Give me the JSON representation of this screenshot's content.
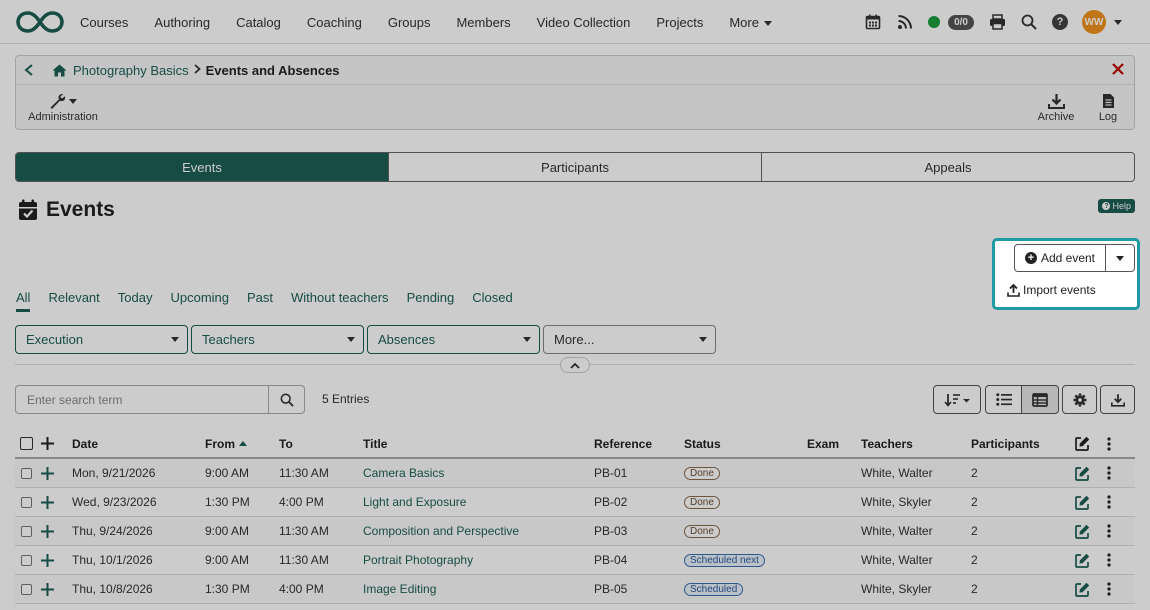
{
  "nav": {
    "items": [
      "Courses",
      "Authoring",
      "Catalog",
      "Coaching",
      "Groups",
      "Members",
      "Video Collection",
      "Projects",
      "More"
    ],
    "counter": "0/0",
    "avatar_initials": "WW",
    "help": "?"
  },
  "breadcrumb": {
    "parent": "Photography Basics",
    "current": "Events and Absences"
  },
  "toolbar": {
    "administration": "Administration",
    "archive": "Archive",
    "log": "Log"
  },
  "tabs": [
    "Events",
    "Participants",
    "Appeals"
  ],
  "page": {
    "title": "Events",
    "help": "Help"
  },
  "scopes": [
    "All",
    "Relevant",
    "Today",
    "Upcoming",
    "Past",
    "Without teachers",
    "Pending",
    "Closed"
  ],
  "filters": [
    "Execution",
    "Teachers",
    "Absences",
    "More..."
  ],
  "search": {
    "placeholder": "Enter search term",
    "entries": "5 Entries"
  },
  "actions": {
    "add_event": "Add event",
    "import_events": "Import events"
  },
  "table": {
    "columns": [
      "Date",
      "From",
      "To",
      "Title",
      "Reference",
      "Status",
      "Exam",
      "Teachers",
      "Participants"
    ],
    "rows": [
      {
        "date": "Mon, 9/21/2026",
        "from": "9:00 AM",
        "to": "11:30 AM",
        "title": "Camera Basics",
        "reference": "PB-01",
        "status": "Done",
        "status_type": "done",
        "exam": "",
        "teachers": "White, Walter",
        "participants": "2"
      },
      {
        "date": "Wed, 9/23/2026",
        "from": "1:30 PM",
        "to": "4:00 PM",
        "title": "Light and Exposure",
        "reference": "PB-02",
        "status": "Done",
        "status_type": "done",
        "exam": "",
        "teachers": "White, Skyler",
        "participants": "2"
      },
      {
        "date": "Thu, 9/24/2026",
        "from": "9:00 AM",
        "to": "11:30 AM",
        "title": "Composition and Perspective",
        "reference": "PB-03",
        "status": "Done",
        "status_type": "done",
        "exam": "",
        "teachers": "White, Walter",
        "participants": "2"
      },
      {
        "date": "Thu, 10/1/2026",
        "from": "9:00 AM",
        "to": "11:30 AM",
        "title": "Portrait Photography",
        "reference": "PB-04",
        "status": "Scheduled next",
        "status_type": "sched",
        "exam": "",
        "teachers": "White, Walter",
        "participants": "2"
      },
      {
        "date": "Thu, 10/8/2026",
        "from": "1:30 PM",
        "to": "4:00 PM",
        "title": "Image Editing",
        "reference": "PB-05",
        "status": "Scheduled",
        "status_type": "sched",
        "exam": "",
        "teachers": "White, Skyler",
        "participants": "2"
      }
    ]
  },
  "colors": {
    "accent": "#1c5f55",
    "highlight": "#1f9aa5",
    "avatar": "#f0931e",
    "online": "#1b9e3e",
    "close": "#c00000"
  }
}
